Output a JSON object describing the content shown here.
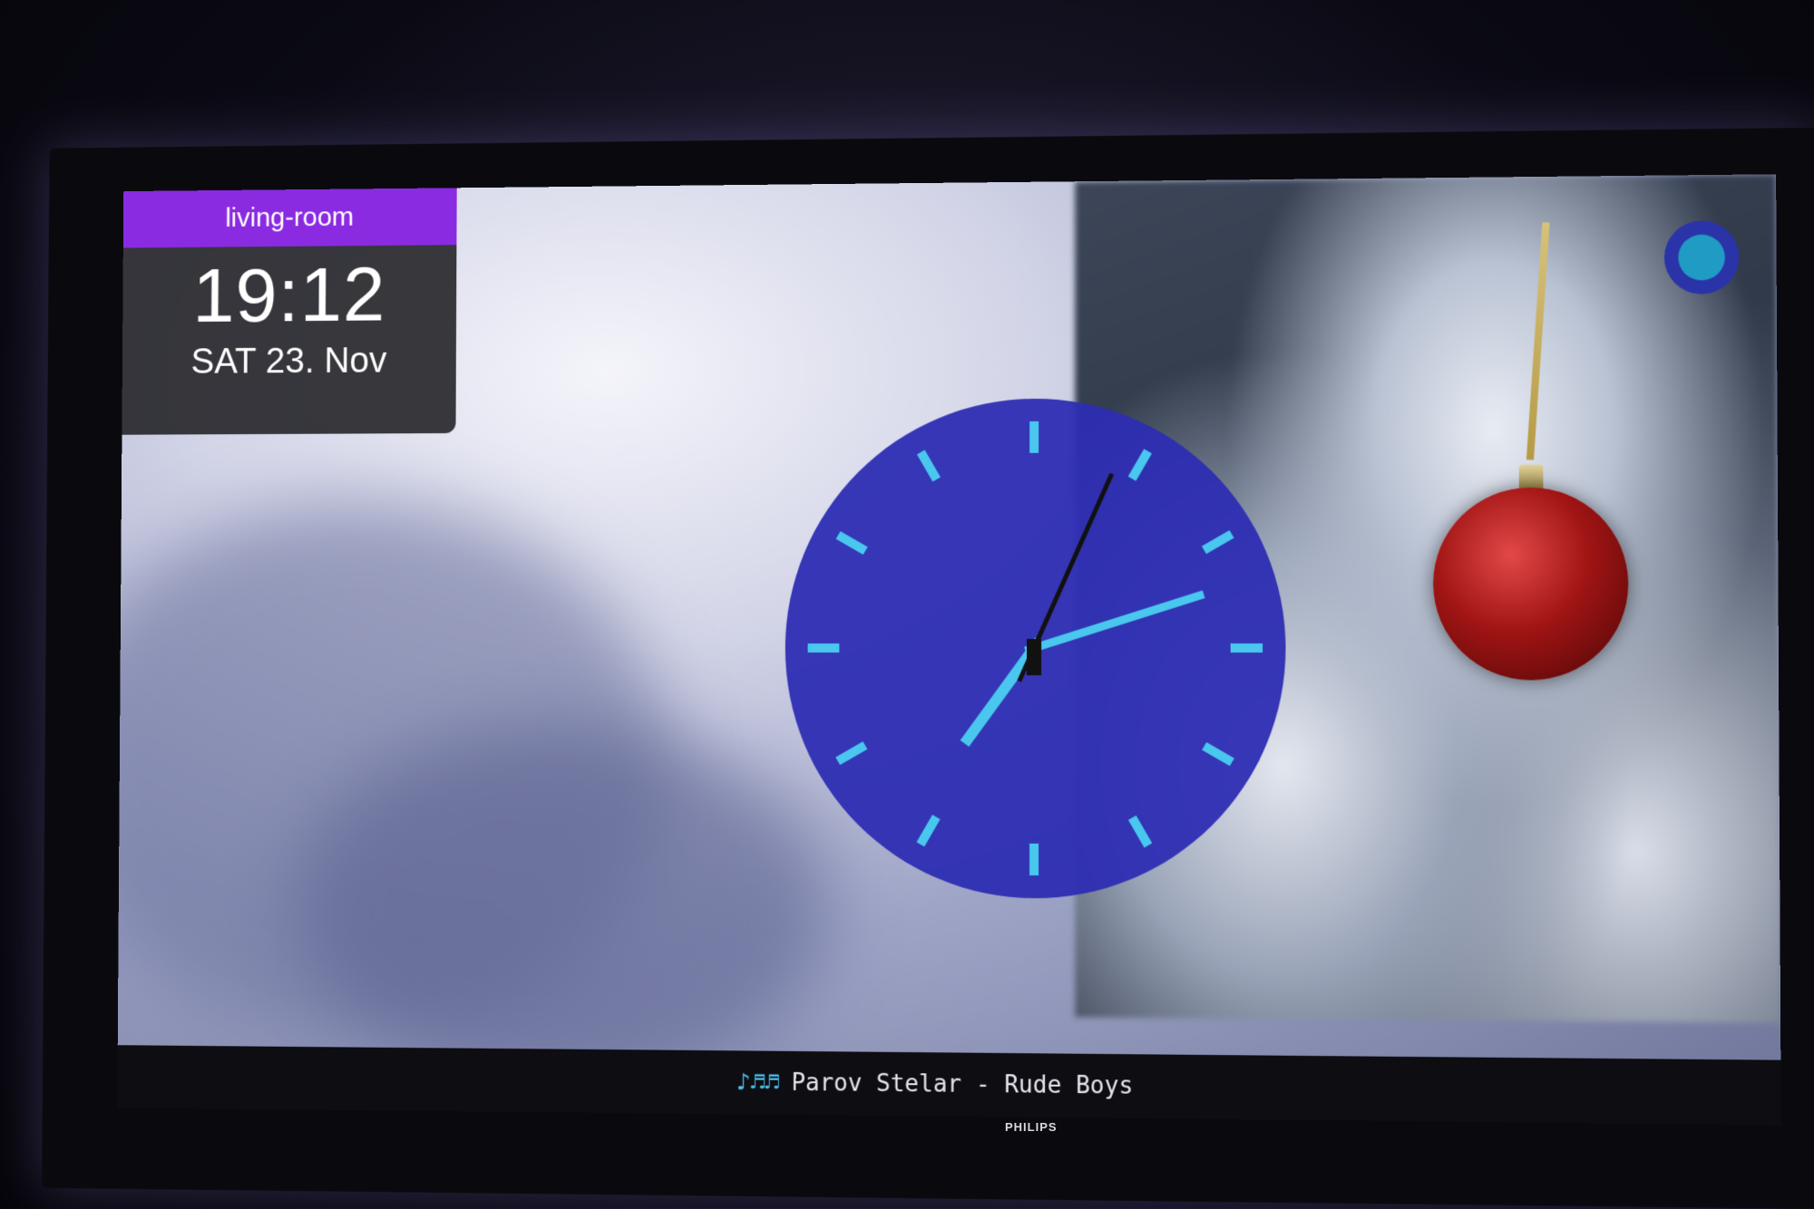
{
  "panel": {
    "room": "living-room",
    "time": "19:12",
    "date": "SAT 23. Nov"
  },
  "clock": {
    "hour": 7,
    "minute": 12,
    "second": 4,
    "face_color": "#2d2db3",
    "tick_color": "#49c7ee",
    "hand_color": "#49c7ee",
    "second_hand_color": "#111111"
  },
  "now_playing": {
    "icon": "music-notes-icon",
    "notes": "♪♬♬",
    "text": "Parov Stelar - Rude Boys"
  },
  "device": {
    "brand": "PHILIPS"
  },
  "colors": {
    "accent": "#8a2be2",
    "panel_bg": "#28282c"
  }
}
